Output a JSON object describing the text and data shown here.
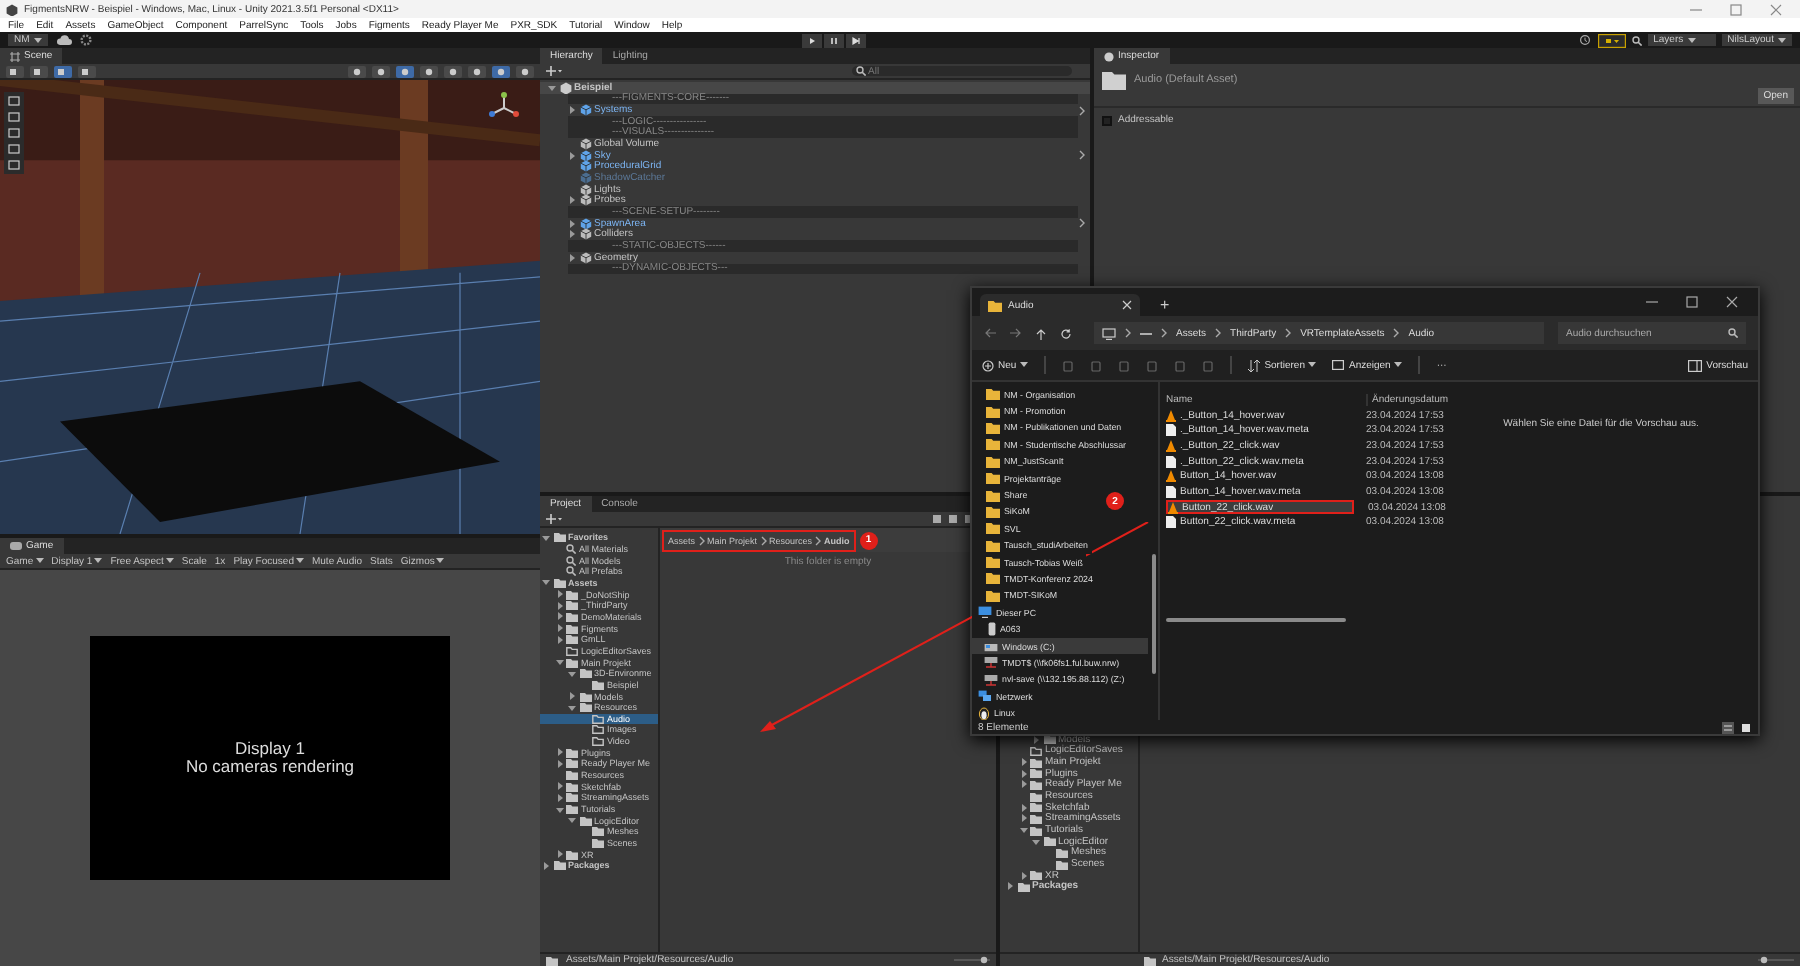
{
  "window": {
    "title": "FigmentsNRW - Beispiel - Windows, Mac, Linux - Unity 2021.3.5f1 Personal <DX11>"
  },
  "menu": [
    "File",
    "Edit",
    "Assets",
    "GameObject",
    "Component",
    "ParrelSync",
    "Tools",
    "Jobs",
    "Figments",
    "Ready Player Me",
    "PXR_SDK",
    "Tutorial",
    "Window",
    "Help"
  ],
  "toolbar": {
    "account": "NM",
    "layers": "Layers",
    "layout": "NilsLayout"
  },
  "scene": {
    "tab": "Scene"
  },
  "game": {
    "tab": "Game",
    "controls": [
      {
        "label": "Game",
        "kind": "dropdown"
      },
      {
        "label": "Display 1",
        "kind": "dropdown"
      },
      {
        "label": "Free Aspect",
        "kind": "dropdown"
      },
      {
        "label": "Scale",
        "kind": "label"
      },
      {
        "label": "1x",
        "kind": "label"
      },
      {
        "label": "Play Focused",
        "kind": "dropdown"
      },
      {
        "label": "Mute Audio",
        "kind": "toggle"
      },
      {
        "label": "Stats",
        "kind": "toggle"
      },
      {
        "label": "Gizmos",
        "kind": "dropdown"
      }
    ],
    "display": "Display 1",
    "message": "No cameras rendering"
  },
  "hierarchy": {
    "tabs": [
      {
        "label": "Hierarchy",
        "selected": true
      },
      {
        "label": "Lighting",
        "selected": false
      }
    ],
    "search": {
      "placeholder": "All"
    },
    "scene": {
      "label": "Beispiel",
      "expanded": true,
      "children": [
        {
          "label": "---FIGMENTS-CORE-------",
          "kind": "separator"
        },
        {
          "label": "Systems",
          "kind": "group",
          "prefab": true,
          "active": true,
          "expanded": false
        },
        {
          "label": "---LOGIC----------------",
          "kind": "separator"
        },
        {
          "label": "---VISUALS---------------",
          "kind": "separator"
        },
        {
          "label": "Global Volume",
          "kind": "object",
          "prefab": false,
          "active": true
        },
        {
          "label": "Sky",
          "kind": "group",
          "prefab": true,
          "active": true,
          "expanded": false
        },
        {
          "label": "ProceduralGrid",
          "kind": "object",
          "prefab": true,
          "active": true
        },
        {
          "label": "ShadowCatcher",
          "kind": "object",
          "prefab": true,
          "active": false
        },
        {
          "label": "Lights",
          "kind": "object",
          "prefab": false,
          "active": true
        },
        {
          "label": "Probes",
          "kind": "group",
          "prefab": false,
          "active": true,
          "expanded": false
        },
        {
          "label": "---SCENE-SETUP--------",
          "kind": "separator"
        },
        {
          "label": "SpawnArea",
          "kind": "group",
          "prefab": true,
          "active": true,
          "expanded": false
        },
        {
          "label": "Colliders",
          "kind": "group",
          "prefab": false,
          "active": true,
          "expanded": false
        },
        {
          "label": "---STATIC-OBJECTS------",
          "kind": "separator"
        },
        {
          "label": "Geometry",
          "kind": "group",
          "prefab": false,
          "active": true,
          "expanded": false
        },
        {
          "label": "---DYNAMIC-OBJECTS---",
          "kind": "separator"
        }
      ]
    }
  },
  "inspector": {
    "tab": "Inspector",
    "asset": "Audio (Default Asset)",
    "open_button": "Open",
    "addressable": {
      "label": "Addressable",
      "checked": false
    }
  },
  "project": {
    "tabs": [
      {
        "label": "Project",
        "selected": true
      },
      {
        "label": "Console",
        "selected": false
      }
    ],
    "tree": [
      {
        "label": "Favorites",
        "kind": "root",
        "expanded": true,
        "selected": false,
        "children": [
          {
            "label": "All Materials",
            "kind": "search",
            "selected": false
          },
          {
            "label": "All Models",
            "kind": "search",
            "selected": false
          },
          {
            "label": "All Prefabs",
            "kind": "search",
            "selected": false
          }
        ]
      },
      {
        "label": "Assets",
        "kind": "root",
        "expanded": true,
        "selected": false,
        "children": [
          {
            "label": "_DoNotShip",
            "kind": "folder",
            "expanded": false,
            "selected": false
          },
          {
            "label": "_ThirdParty",
            "kind": "folder",
            "expanded": false,
            "selected": false
          },
          {
            "label": "DemoMaterials",
            "kind": "folder",
            "expanded": false,
            "selected": false
          },
          {
            "label": "Figments",
            "kind": "folder",
            "expanded": false,
            "selected": false
          },
          {
            "label": "GmLL",
            "kind": "folder",
            "expanded": false,
            "selected": false
          },
          {
            "label": "LogicEditorSaves",
            "kind": "empty",
            "selected": false
          },
          {
            "label": "Main Projekt",
            "kind": "folder",
            "expanded": true,
            "selected": false,
            "children": [
              {
                "label": "3D-Environme",
                "kind": "folder",
                "expanded": true,
                "selected": false,
                "children": [
                  {
                    "label": "Beispiel",
                    "kind": "leaf",
                    "selected": false
                  }
                ]
              },
              {
                "label": "Models",
                "kind": "folder",
                "expanded": false,
                "selected": false
              },
              {
                "label": "Resources",
                "kind": "folder",
                "expanded": true,
                "selected": false,
                "children": [
                  {
                    "label": "Audio",
                    "kind": "empty",
                    "selected": true
                  },
                  {
                    "label": "Images",
                    "kind": "empty",
                    "selected": false
                  },
                  {
                    "label": "Video",
                    "kind": "empty",
                    "selected": false
                  }
                ]
              }
            ]
          },
          {
            "label": "Plugins",
            "kind": "folder",
            "expanded": false,
            "selected": false
          },
          {
            "label": "Ready Player Me",
            "kind": "folder",
            "expanded": false,
            "selected": false
          },
          {
            "label": "Resources",
            "kind": "leaf",
            "selected": false
          },
          {
            "label": "Sketchfab",
            "kind": "folder",
            "expanded": false,
            "selected": false
          },
          {
            "label": "StreamingAssets",
            "kind": "folder",
            "expanded": false,
            "selected": false
          },
          {
            "label": "Tutorials",
            "kind": "folder",
            "expanded": true,
            "selected": false,
            "children": [
              {
                "label": "LogicEditor",
                "kind": "folder",
                "expanded": true,
                "selected": false,
                "children": [
                  {
                    "label": "Meshes",
                    "kind": "leaf",
                    "selected": false
                  },
                  {
                    "label": "Scenes",
                    "kind": "leaf",
                    "selected": false
                  }
                ]
              }
            ]
          },
          {
            "label": "XR",
            "kind": "folder",
            "expanded": false,
            "selected": false
          }
        ]
      },
      {
        "label": "Packages",
        "kind": "root",
        "expanded": false,
        "selected": false
      }
    ],
    "breadcrumb": [
      "Assets",
      "Main Projekt",
      "Resources",
      "Audio"
    ],
    "empty_message": "This folder is empty",
    "status_path": "Assets/Main Projekt/Resources/Audio"
  },
  "project_2": {
    "tree": [
      {
        "children": [
          {
            "children": [
              {
                "label": "Models",
                "kind": "folder",
                "expanded": false
              }
            ]
          },
          {
            "label": "LogicEditorSaves",
            "kind": "empty"
          },
          {
            "label": "Main Projekt",
            "kind": "folder",
            "expanded": false
          },
          {
            "label": "Plugins",
            "kind": "folder",
            "expanded": false
          },
          {
            "label": "Ready Player Me",
            "kind": "folder",
            "expanded": false
          },
          {
            "label": "Resources",
            "kind": "leaf"
          },
          {
            "label": "Sketchfab",
            "kind": "folder",
            "expanded": false
          },
          {
            "label": "StreamingAssets",
            "kind": "folder",
            "expanded": false
          },
          {
            "label": "Tutorials",
            "kind": "folder",
            "expanded": true,
            "children": [
              {
                "label": "LogicEditor",
                "kind": "folder",
                "expanded": true,
                "children": [
                  {
                    "label": "Meshes",
                    "kind": "leaf"
                  },
                  {
                    "label": "Scenes",
                    "kind": "leaf"
                  }
                ]
              }
            ]
          },
          {
            "label": "XR",
            "kind": "folder",
            "expanded": false
          }
        ]
      },
      {
        "label": "Packages",
        "kind": "root",
        "expanded": false
      }
    ],
    "status_path": "Assets/Main Projekt/Resources/Audio"
  },
  "explorer": {
    "tab": "Audio",
    "new_tab": "+",
    "breadcrumb": [
      "Assets",
      "ThirdParty",
      "VRTemplateAssets",
      "Audio"
    ],
    "search": {
      "placeholder": "Audio durchsuchen"
    },
    "commands": {
      "new": "Neu",
      "sort": "Sortieren",
      "view": "Anzeigen",
      "more": "···",
      "preview": "Vorschau"
    },
    "sidebar": [
      {
        "label": "NM - Organisation",
        "kind": "folder",
        "selected": false
      },
      {
        "label": "NM - Promotion",
        "kind": "folder",
        "selected": false
      },
      {
        "label": "NM - Publikationen und Daten",
        "kind": "folder",
        "selected": false
      },
      {
        "label": "NM - Studentische Abschlussar",
        "kind": "folder",
        "selected": false
      },
      {
        "label": "NM_JustScanIt",
        "kind": "folder",
        "selected": false
      },
      {
        "label": "Projektanträge",
        "kind": "folder",
        "selected": false
      },
      {
        "label": "Share",
        "kind": "folder",
        "selected": false
      },
      {
        "label": "SiKoM",
        "kind": "folder",
        "selected": false
      },
      {
        "label": "SVL",
        "kind": "folder",
        "selected": false
      },
      {
        "label": "Tausch_studiArbeiten",
        "kind": "folder",
        "selected": false
      },
      {
        "label": "Tausch-Tobias Weiß",
        "kind": "folder",
        "selected": false
      },
      {
        "label": "TMDT-Konferenz 2024",
        "kind": "folder",
        "selected": false
      },
      {
        "label": "TMDT-SIKoM",
        "kind": "folder",
        "selected": false
      },
      {
        "label": "Dieser PC",
        "kind": "pc",
        "selected": false
      },
      {
        "label": "A063",
        "kind": "device",
        "selected": false
      },
      {
        "label": "Windows (C:)",
        "kind": "drive",
        "selected": true
      },
      {
        "label": "TMDT$ (\\\\fk06fs1.ful.buw.nrw)",
        "kind": "netdrive",
        "selected": false
      },
      {
        "label": "nvl-save (\\\\132.195.88.112) (Z:)",
        "kind": "netdrive",
        "selected": false
      },
      {
        "label": "Netzwerk",
        "kind": "network",
        "selected": false
      },
      {
        "label": "Linux",
        "kind": "linux",
        "selected": false
      }
    ],
    "columns": [
      "Name",
      "Änderungsdatum"
    ],
    "files": [
      {
        "name": "._Button_14_hover.wav",
        "date": "23.04.2024 17:53",
        "kind": "audio",
        "selected": false
      },
      {
        "name": "._Button_14_hover.wav.meta",
        "date": "23.04.2024 17:53",
        "kind": "file",
        "selected": false
      },
      {
        "name": "._Button_22_click.wav",
        "date": "23.04.2024 17:53",
        "kind": "audio",
        "selected": false
      },
      {
        "name": "._Button_22_click.wav.meta",
        "date": "23.04.2024 17:53",
        "kind": "file",
        "selected": false
      },
      {
        "name": "Button_14_hover.wav",
        "date": "03.04.2024 13:08",
        "kind": "audio",
        "selected": false
      },
      {
        "name": "Button_14_hover.wav.meta",
        "date": "03.04.2024 13:08",
        "kind": "file",
        "selected": false
      },
      {
        "name": "Button_22_click.wav",
        "date": "03.04.2024 13:08",
        "kind": "audio",
        "selected": true
      },
      {
        "name": "Button_22_click.wav.meta",
        "date": "03.04.2024 13:08",
        "kind": "file",
        "selected": false
      }
    ],
    "preview_hint": "Wählen Sie eine Datei für die Vorschau aus.",
    "status": "8 Elemente"
  },
  "annotations": {
    "badges": [
      "1",
      "2"
    ]
  }
}
